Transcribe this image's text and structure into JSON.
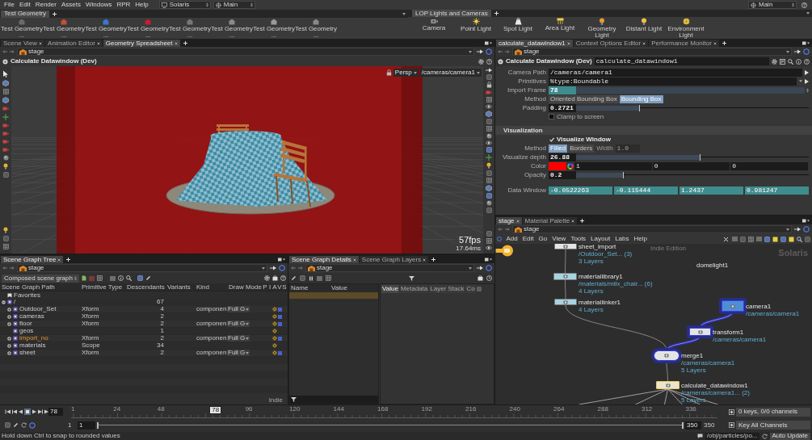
{
  "menu_bar": {
    "items": [
      "File",
      "Edit",
      "Render",
      "Assets",
      "Windows",
      "RPR",
      "Help"
    ],
    "desktop": "Solaris",
    "context": "Main",
    "right_context": "Main"
  },
  "shelves": [
    {
      "tab": "Test Geometry",
      "tools": [
        "Test Geometry ...",
        "Test Geometry ...",
        "Test Geometry ...",
        "Test Geometry ...",
        "Test Geometry ...",
        "Test Geometry ...",
        "Test Geometry ...",
        "Test Geometry ..."
      ]
    },
    {
      "tab": "LOP Lights and Cameras",
      "tools": [
        "Camera",
        "Point Light",
        "Spot Light",
        "Area Light",
        "Geometry Light",
        "Distant Light",
        "Environment Light"
      ]
    }
  ],
  "viewer_pane": {
    "tabs": [
      {
        "label": "Scene View",
        "selected": false
      },
      {
        "label": "Animation Editor",
        "selected": false
      },
      {
        "label": "Geometry Spreadsheet",
        "selected": true
      }
    ],
    "path": "stage",
    "title": "Calculate Datawindow (Dev)",
    "view": "Persp",
    "camera": "/cameras/camera1",
    "fps": "57fps",
    "frame_time": "17.64ms"
  },
  "parameter_pane": {
    "tabs": [
      {
        "label": "calculate_datawindow1",
        "selected": true
      },
      {
        "label": "Context Options Editor",
        "selected": false
      },
      {
        "label": "Performance Monitor",
        "selected": false
      }
    ],
    "path": "stage",
    "node_type": "Calculate Datawindow (Dev)",
    "node_name": "calculate_datawindow1",
    "parameters": [
      {
        "kind": "text",
        "label": "Camera Path",
        "value": "/cameras/camera1"
      },
      {
        "kind": "text",
        "label": "Primitives",
        "value": "%type:Boundable",
        "menu": true
      },
      {
        "kind": "expression",
        "label": "Import Frame",
        "value": "78"
      },
      {
        "kind": "buttons",
        "label": "Method",
        "options": [
          {
            "label": "Oriented Bounding Box",
            "selected": false
          },
          {
            "label": "Bounding Box",
            "selected": true
          }
        ]
      },
      {
        "kind": "slider",
        "label": "Padding",
        "value": "0.2721",
        "level": 0.27
      },
      {
        "kind": "checkbox",
        "label": "Clamp to screen",
        "checked": false
      },
      {
        "kind": "section",
        "label": "Visualization"
      },
      {
        "kind": "checkbox",
        "label": "Visualize Window",
        "checked": true
      },
      {
        "kind": "buttons",
        "label": "Method",
        "options": [
          {
            "label": "Filled",
            "selected": true
          },
          {
            "label": "Borders",
            "selected": false
          }
        ],
        "extra": {
          "label": "Width",
          "value": "1.0",
          "disabled": true
        }
      },
      {
        "kind": "slider",
        "label": "Visualize depth",
        "value": "26.88",
        "level": 0.53
      },
      {
        "kind": "color",
        "label": "Color",
        "color": "#ff0000",
        "values": [
          "1",
          "0",
          "0"
        ]
      },
      {
        "kind": "slider",
        "label": "Opacity",
        "value": "0.2",
        "level": 0.2
      },
      {
        "kind": "vector",
        "label": "Data Window",
        "values": [
          "-0.0522263",
          "-0.115444",
          "1.2437",
          "0.981247"
        ]
      }
    ]
  },
  "scene_graph_tree": {
    "tabs": [
      {
        "label": "Scene Graph Tree",
        "selected": true
      }
    ],
    "path": "stage",
    "mode": "Composed scene graph",
    "columns": [
      "Scene Graph Path",
      "Primitive Type",
      "Descendants",
      "Variants",
      "Kind",
      "Draw Mode",
      "P",
      "I",
      "A",
      "V",
      "S"
    ],
    "favorites": "Favorites",
    "rows": [
      {
        "name": "/",
        "descendants": "67",
        "expanded": true,
        "highlighted": false,
        "children": [
          {
            "name": "Outdoor_Set",
            "type": "Xform",
            "descendants": "4",
            "model_kind": "componen",
            "draw_mode": "Full G",
            "expanded": false,
            "highlighted": false,
            "active": true,
            "visible": true
          },
          {
            "name": "cameras",
            "type": "Xform",
            "descendants": "2",
            "expanded": false,
            "highlighted": false,
            "active": true,
            "visible": true
          },
          {
            "name": "floor",
            "type": "Xform",
            "descendants": "2",
            "model_kind": "componen",
            "draw_mode": "Full G",
            "expanded": false,
            "highlighted": false,
            "active": true,
            "visible": true
          },
          {
            "name": "geos",
            "descendants": "1",
            "highlighted": false,
            "active": true,
            "visible": false
          },
          {
            "name": "import_no",
            "type": "Xform",
            "descendants": "2",
            "model_kind": "componen",
            "draw_mode": "Full G",
            "expanded": false,
            "highlighted": true,
            "active": true,
            "visible": true
          },
          {
            "name": "materials",
            "type": "Scope",
            "descendants": "34",
            "expanded": false,
            "highlighted": false,
            "active": true,
            "visible": false
          },
          {
            "name": "sheet",
            "type": "Xform",
            "descendants": "2",
            "model_kind": "componen",
            "draw_mode": "Full G",
            "expanded": false,
            "highlighted": false,
            "active": true,
            "visible": true
          }
        ]
      }
    ],
    "footer": "Indie"
  },
  "scene_graph_details": {
    "tabs": [
      {
        "label": "Scene Graph Details",
        "selected": true
      },
      {
        "label": "Scene Graph Layers",
        "selected": false
      }
    ],
    "path": "stage",
    "columns": [
      "Name",
      "Value"
    ],
    "inspector_tabs": [
      {
        "label": "Value",
        "selected": true
      },
      {
        "label": "Metadata",
        "selected": false
      },
      {
        "label": "Layer Stack",
        "selected": false
      },
      {
        "label": "Co",
        "selected": false
      }
    ]
  },
  "network_pane": {
    "tabs": [
      {
        "label": "stage",
        "selected": true
      },
      {
        "label": "Material Palette",
        "selected": false
      }
    ],
    "path": "stage",
    "menu": [
      "Add",
      "Edit",
      "Go",
      "View",
      "Tools",
      "Layout",
      "Labs",
      "Help"
    ],
    "edition": "Indie Edition",
    "context_label": "Solaris",
    "nodes": [
      {
        "name": "sheet_import",
        "kind": "lop",
        "color": "#e4e4e4",
        "info": [
          "/Outdoor_Set... (3)",
          "3 Layers"
        ],
        "highlighted": false,
        "selected": false
      },
      {
        "name": "materiallibrary1",
        "kind": "lop",
        "color": "#a8d3e2",
        "info": [
          "/materials/mtlx_chair... (6)",
          "4 Layers"
        ],
        "highlighted": false,
        "selected": false
      },
      {
        "name": "domelight1",
        "kind": "light",
        "color": "#f2b22e",
        "highlighted": false,
        "selected": false
      },
      {
        "name": "materiallinker1",
        "kind": "lop",
        "color": "#a8d3e2",
        "info": [
          "4 Layers"
        ],
        "highlighted": false,
        "selected": false
      },
      {
        "name": "camera1",
        "kind": "lop",
        "color": "#4f8ed6",
        "info": [
          "/cameras/camera1"
        ],
        "highlighted": true,
        "selected": false
      },
      {
        "name": "transform1",
        "kind": "lop",
        "color": "#e4e4e4",
        "info": [
          "/cameras/camera1"
        ],
        "highlighted": true,
        "selected": false
      },
      {
        "name": "merge1",
        "kind": "merge",
        "color": "#e4e4e4",
        "info": [
          "/cameras/camera1",
          "5 Layers"
        ],
        "highlighted": true,
        "selected": false
      },
      {
        "name": "calculate_datawindow1",
        "kind": "lop",
        "color": "#ece4cc",
        "info": [
          "/cameras/camera1... (2)",
          "5 Layers"
        ],
        "highlighted": false,
        "selected": true
      }
    ]
  },
  "timeline": {
    "frame": "78",
    "playhead": {
      "label": "78",
      "level": 0.22
    },
    "ticks": [
      "1",
      "24",
      "48",
      "96",
      "120",
      "144",
      "168",
      "192",
      "216",
      "240",
      "264",
      "288",
      "312",
      "336"
    ],
    "range_start": "1",
    "start_field": "1",
    "range_bar": {
      "level": 1
    },
    "end_field": "350",
    "range_end": "350",
    "keys_info": "0 keys, 0/0 channels",
    "key_all": "Key All Channels"
  },
  "status_bar": {
    "message": "Hold down Ctrl to snap to rounded values",
    "path": "/obj/particles/po...",
    "update_mode": "Auto Update"
  }
}
